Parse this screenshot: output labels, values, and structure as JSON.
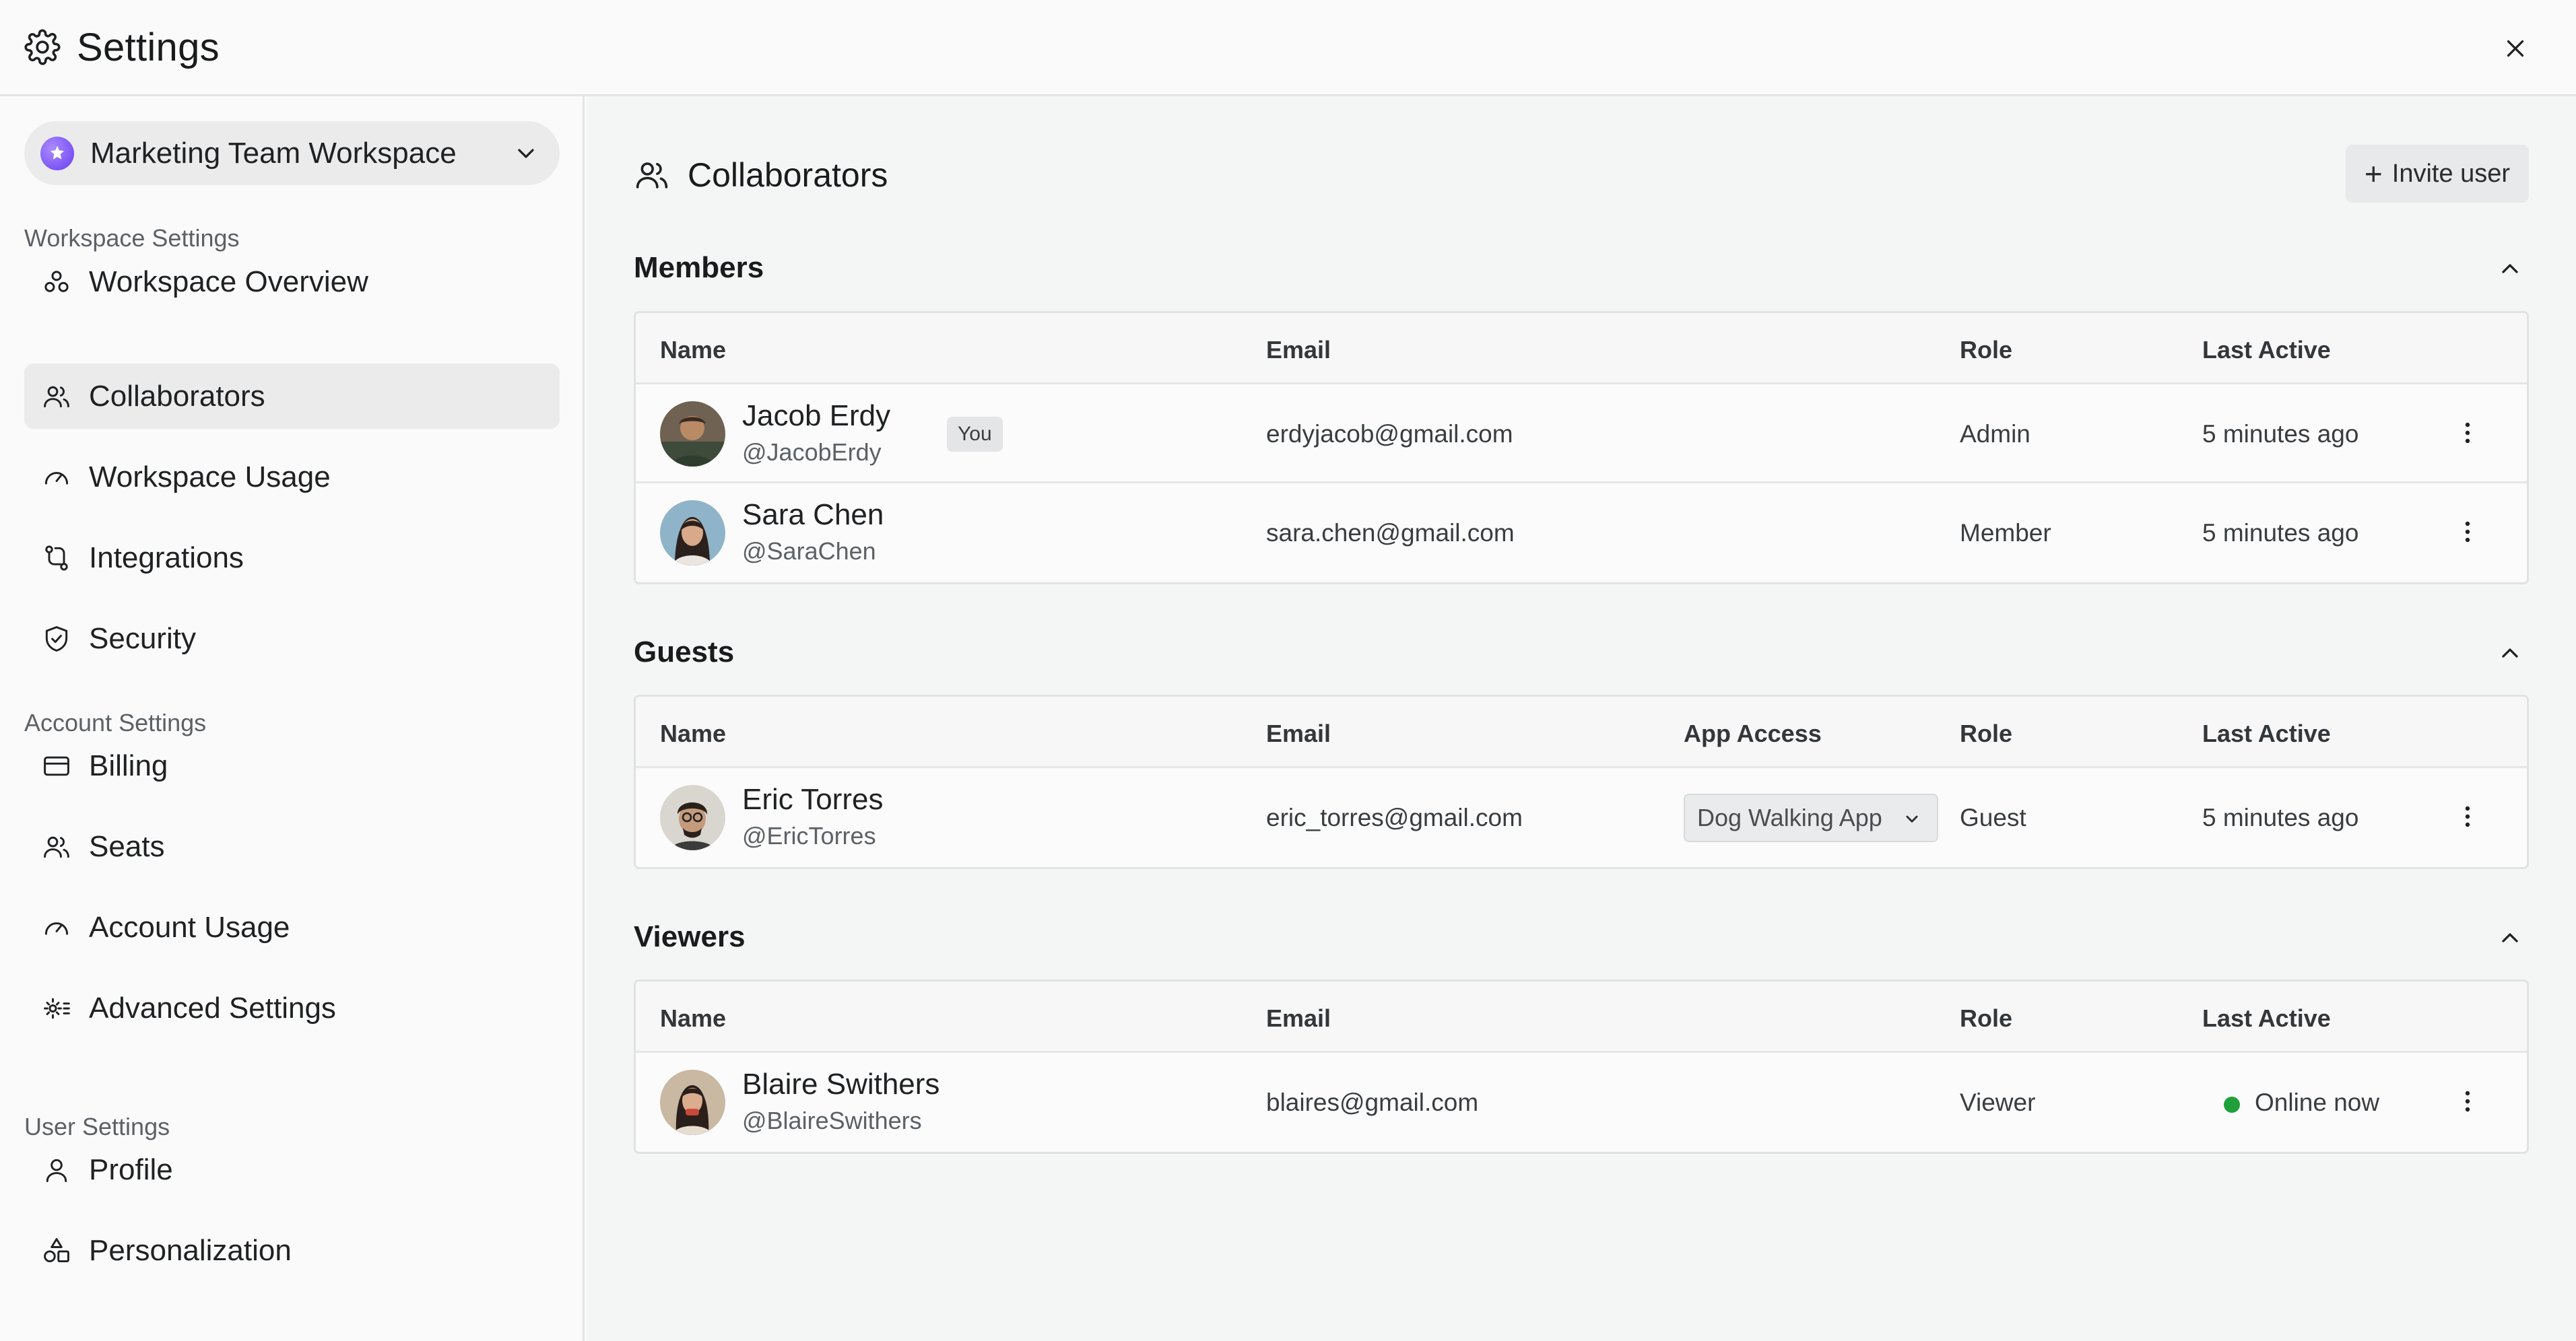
{
  "window": {
    "title": "Settings"
  },
  "workspace": {
    "name": "Marketing Team Workspace"
  },
  "sidebar": {
    "sections": [
      {
        "label": "Workspace Settings"
      },
      {
        "label": "Account Settings"
      },
      {
        "label": "User Settings"
      }
    ],
    "items": [
      {
        "label": "Workspace Overview",
        "icon": "overview-icon"
      },
      {
        "label": "Collaborators",
        "icon": "users-icon",
        "active": true
      },
      {
        "label": "Workspace Usage",
        "icon": "gauge-icon"
      },
      {
        "label": "Integrations",
        "icon": "integrations-icon"
      },
      {
        "label": "Security",
        "icon": "shield-icon"
      },
      {
        "label": "Billing",
        "icon": "credit-card-icon"
      },
      {
        "label": "Seats",
        "icon": "users-icon"
      },
      {
        "label": "Account Usage",
        "icon": "gauge-icon"
      },
      {
        "label": "Advanced Settings",
        "icon": "gear-list-icon"
      },
      {
        "label": "Profile",
        "icon": "user-icon"
      },
      {
        "label": "Personalization",
        "icon": "shapes-icon"
      }
    ]
  },
  "main": {
    "title": "Collaborators",
    "invite_label": "Invite user",
    "columns": {
      "name": "Name",
      "email": "Email",
      "app_access": "App Access",
      "role": "Role",
      "last_active": "Last Active"
    },
    "members": {
      "title": "Members",
      "rows": [
        {
          "name": "Jacob Erdy",
          "handle": "@JacobErdy",
          "badge": "You",
          "email": "erdyjacob@gmail.com",
          "role": "Admin",
          "last_active": "5 minutes ago"
        },
        {
          "name": "Sara Chen",
          "handle": "@SaraChen",
          "email": "sara.chen@gmail.com",
          "role": "Member",
          "last_active": "5 minutes ago"
        }
      ]
    },
    "guests": {
      "title": "Guests",
      "rows": [
        {
          "name": "Eric Torres",
          "handle": "@EricTorres",
          "email": "eric_torres@gmail.com",
          "app_access": "Dog Walking App",
          "role": "Guest",
          "last_active": "5 minutes ago"
        }
      ]
    },
    "viewers": {
      "title": "Viewers",
      "rows": [
        {
          "name": "Blaire Swithers",
          "handle": "@BlaireSwithers",
          "email": "blaires@gmail.com",
          "role": "Viewer",
          "last_active": "Online now",
          "status_color": "#1fa03a"
        }
      ]
    }
  }
}
